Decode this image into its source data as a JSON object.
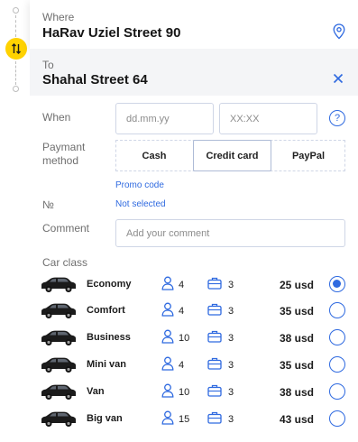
{
  "route": {
    "where_label": "Where",
    "where_value": "HaRav Uziel Street 90",
    "to_label": "To",
    "to_value": "Shahal Street 64"
  },
  "form": {
    "when_label": "When",
    "date_placeholder": "dd.mm.yy",
    "time_placeholder": "XX:XX",
    "help_symbol": "?",
    "payment_label": "Paymant method",
    "payment_options": [
      "Cash",
      "Credit card",
      "PayPal"
    ],
    "payment_selected": "Credit card",
    "promo_link": "Promo code",
    "number_label": "№",
    "number_value": "Not selected",
    "comment_label": "Comment",
    "comment_placeholder": "Add your comment",
    "car_class_label": "Car class"
  },
  "cars": [
    {
      "name": "Economy",
      "passengers": "4",
      "bags": "3",
      "price": "25 usd",
      "selected": true
    },
    {
      "name": "Comfort",
      "passengers": "4",
      "bags": "3",
      "price": "35 usd",
      "selected": false
    },
    {
      "name": "Business",
      "passengers": "10",
      "bags": "3",
      "price": "38 usd",
      "selected": false
    },
    {
      "name": "Mini van",
      "passengers": "4",
      "bags": "3",
      "price": "35 usd",
      "selected": false
    },
    {
      "name": "Van",
      "passengers": "10",
      "bags": "3",
      "price": "38 usd",
      "selected": false
    },
    {
      "name": "Big van",
      "passengers": "15",
      "bags": "3",
      "price": "43 usd",
      "selected": false
    }
  ],
  "icons": {
    "swap": "swap-arrows-icon",
    "location": "location-pin-icon",
    "close": "close-icon",
    "help": "help-icon",
    "passenger": "passenger-icon",
    "luggage": "luggage-icon",
    "car": "car-icon"
  },
  "colors": {
    "accent": "#2f6ae0",
    "swap_button": "#ffd200",
    "to_card_bg": "#f4f5f7",
    "input_border": "#cfd6e6"
  }
}
